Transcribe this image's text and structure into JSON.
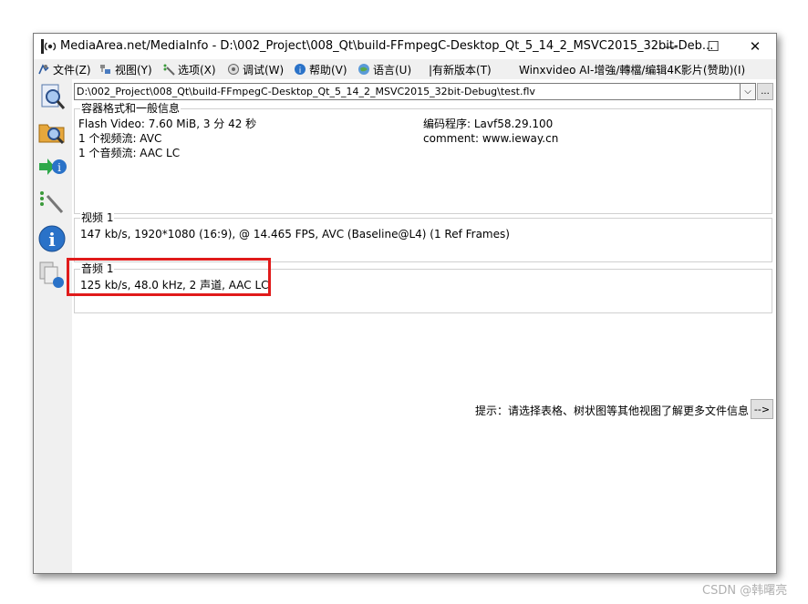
{
  "window": {
    "title": "MediaArea.net/MediaInfo - D:\\002_Project\\008_Qt\\build-FFmpegC-Desktop_Qt_5_14_2_MSVC2015_32bit-Deb...",
    "minimize": "—",
    "maximize": "☐",
    "close": "✕"
  },
  "menu": {
    "items": [
      {
        "label": "文件(Z)",
        "icon": "file-icon"
      },
      {
        "label": "视图(Y)",
        "icon": "view-icon"
      },
      {
        "label": "选项(X)",
        "icon": "options-icon"
      },
      {
        "label": "调试(W)",
        "icon": "debug-icon"
      },
      {
        "label": "帮助(V)",
        "icon": "help-icon"
      },
      {
        "label": "语言(U)",
        "icon": "language-icon"
      },
      {
        "label": "|有新版本(T)",
        "icon": ""
      },
      {
        "label": "Winxvideo AI-增強/轉檔/编辑4K影片(赞助)(I)",
        "icon": ""
      }
    ]
  },
  "toolbar": {
    "icons": [
      "open-file-icon",
      "open-folder-icon",
      "export-icon",
      "settings-icon",
      "about-icon",
      "sheet-view-icon"
    ]
  },
  "path": {
    "value": "D:\\002_Project\\008_Qt\\build-FFmpegC-Desktop_Qt_5_14_2_MSVC2015_32bit-Debug\\test.flv",
    "dropdown": "⌵",
    "more": "..."
  },
  "general": {
    "title": "容器格式和一般信息",
    "left_lines": [
      "Flash Video: 7.60 MiB, 3 分 42 秒",
      "1 个视频流: AVC",
      "1 个音频流: AAC LC"
    ],
    "right_lines": [
      "编码程序: Lavf58.29.100",
      "comment: www.ieway.cn"
    ]
  },
  "video": {
    "title": "视频 1",
    "line": "147 kb/s, 1920*1080 (16:9), @ 14.465 FPS, AVC (Baseline@L4) (1 Ref Frames)"
  },
  "audio": {
    "title": "音频 1",
    "line": "125 kb/s, 48.0 kHz, 2 声道, AAC LC"
  },
  "hint": {
    "text": "提示：请选择表格、树状图等其他视图了解更多文件信息",
    "button": "-->"
  },
  "watermark": "CSDN @韩曙亮",
  "colors": {
    "highlight": "#e01b1b"
  }
}
